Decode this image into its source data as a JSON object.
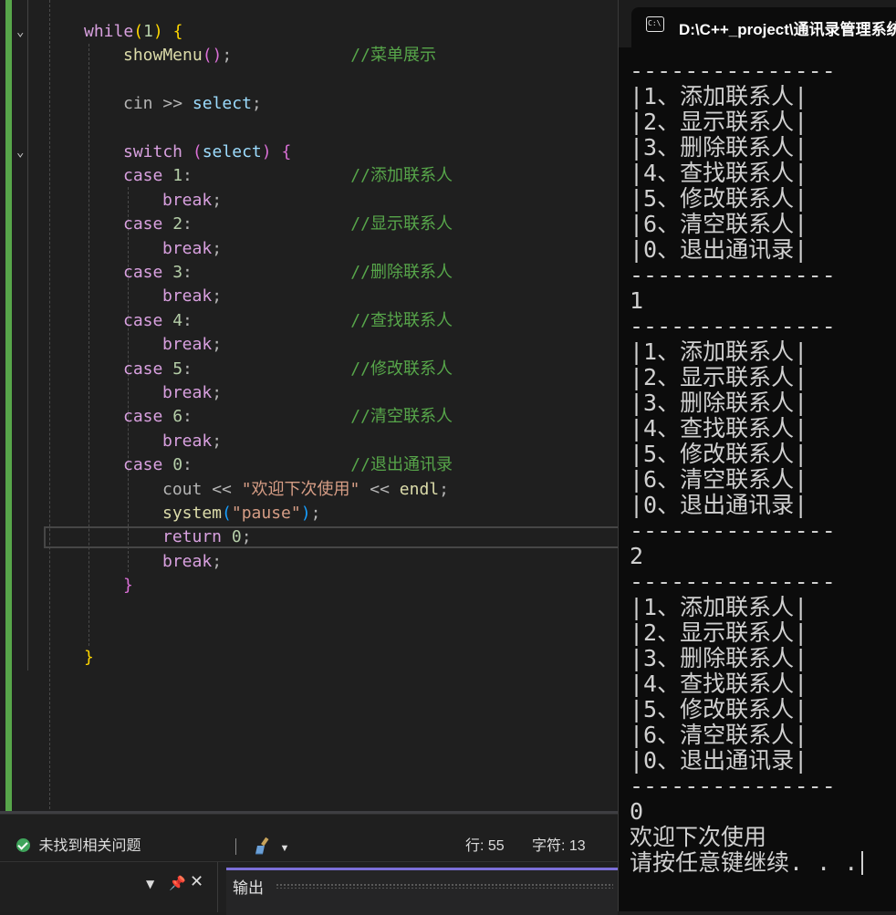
{
  "editor": {
    "lines": [
      {
        "indent": 0,
        "tokens": [
          [
            "kw",
            "while"
          ],
          [
            "br1",
            "("
          ],
          [
            "num",
            "1"
          ],
          [
            "br1",
            ")"
          ],
          [
            "op",
            " "
          ],
          [
            "br1",
            "{"
          ]
        ]
      },
      {
        "indent": 1,
        "tokens": [
          [
            "fn",
            "showMenu"
          ],
          [
            "br2",
            "()"
          ],
          [
            "op",
            ";"
          ],
          [
            "op",
            "            "
          ],
          [
            "cmt",
            "//菜单展示"
          ]
        ]
      },
      {
        "indent": 1,
        "tokens": []
      },
      {
        "indent": 1,
        "tokens": [
          [
            "op",
            "cin "
          ],
          [
            "op",
            ">>"
          ],
          [
            "op",
            " "
          ],
          [
            "var",
            "select"
          ],
          [
            "op",
            ";"
          ]
        ]
      },
      {
        "indent": 1,
        "tokens": []
      },
      {
        "indent": 1,
        "tokens": [
          [
            "kw",
            "switch"
          ],
          [
            "op",
            " "
          ],
          [
            "br2",
            "("
          ],
          [
            "var",
            "select"
          ],
          [
            "br2",
            ")"
          ],
          [
            "op",
            " "
          ],
          [
            "br2",
            "{"
          ]
        ]
      },
      {
        "indent": 1,
        "tokens": [
          [
            "kw",
            "case"
          ],
          [
            "op",
            " "
          ],
          [
            "num",
            "1"
          ],
          [
            "op",
            ":"
          ],
          [
            "op",
            "                "
          ],
          [
            "cmt",
            "//添加联系人"
          ]
        ]
      },
      {
        "indent": 2,
        "tokens": [
          [
            "kw",
            "break"
          ],
          [
            "op",
            ";"
          ]
        ]
      },
      {
        "indent": 1,
        "tokens": [
          [
            "kw",
            "case"
          ],
          [
            "op",
            " "
          ],
          [
            "num",
            "2"
          ],
          [
            "op",
            ":"
          ],
          [
            "op",
            "                "
          ],
          [
            "cmt",
            "//显示联系人"
          ]
        ]
      },
      {
        "indent": 2,
        "tokens": [
          [
            "kw",
            "break"
          ],
          [
            "op",
            ";"
          ]
        ]
      },
      {
        "indent": 1,
        "tokens": [
          [
            "kw",
            "case"
          ],
          [
            "op",
            " "
          ],
          [
            "num",
            "3"
          ],
          [
            "op",
            ":"
          ],
          [
            "op",
            "                "
          ],
          [
            "cmt",
            "//删除联系人"
          ]
        ]
      },
      {
        "indent": 2,
        "tokens": [
          [
            "kw",
            "break"
          ],
          [
            "op",
            ";"
          ]
        ]
      },
      {
        "indent": 1,
        "tokens": [
          [
            "kw",
            "case"
          ],
          [
            "op",
            " "
          ],
          [
            "num",
            "4"
          ],
          [
            "op",
            ":"
          ],
          [
            "op",
            "                "
          ],
          [
            "cmt",
            "//查找联系人"
          ]
        ]
      },
      {
        "indent": 2,
        "tokens": [
          [
            "kw",
            "break"
          ],
          [
            "op",
            ";"
          ]
        ]
      },
      {
        "indent": 1,
        "tokens": [
          [
            "kw",
            "case"
          ],
          [
            "op",
            " "
          ],
          [
            "num",
            "5"
          ],
          [
            "op",
            ":"
          ],
          [
            "op",
            "                "
          ],
          [
            "cmt",
            "//修改联系人"
          ]
        ]
      },
      {
        "indent": 2,
        "tokens": [
          [
            "kw",
            "break"
          ],
          [
            "op",
            ";"
          ]
        ]
      },
      {
        "indent": 1,
        "tokens": [
          [
            "kw",
            "case"
          ],
          [
            "op",
            " "
          ],
          [
            "num",
            "6"
          ],
          [
            "op",
            ":"
          ],
          [
            "op",
            "                "
          ],
          [
            "cmt",
            "//清空联系人"
          ]
        ]
      },
      {
        "indent": 2,
        "tokens": [
          [
            "kw",
            "break"
          ],
          [
            "op",
            ";"
          ]
        ]
      },
      {
        "indent": 1,
        "tokens": [
          [
            "kw",
            "case"
          ],
          [
            "op",
            " "
          ],
          [
            "num",
            "0"
          ],
          [
            "op",
            ":"
          ],
          [
            "op",
            "                "
          ],
          [
            "cmt",
            "//退出通讯录"
          ]
        ]
      },
      {
        "indent": 2,
        "tokens": [
          [
            "op",
            "cout "
          ],
          [
            "op",
            "<<"
          ],
          [
            "op",
            " "
          ],
          [
            "str",
            "\"欢迎下次使用\""
          ],
          [
            "op",
            " "
          ],
          [
            "op",
            "<<"
          ],
          [
            "op",
            " "
          ],
          [
            "fn",
            "endl"
          ],
          [
            "op",
            ";"
          ]
        ]
      },
      {
        "indent": 2,
        "tokens": [
          [
            "fn",
            "system"
          ],
          [
            "br3",
            "("
          ],
          [
            "str",
            "\"pause\""
          ],
          [
            "br3",
            ")"
          ],
          [
            "op",
            ";"
          ]
        ]
      },
      {
        "indent": 2,
        "tokens": [
          [
            "kw",
            "return"
          ],
          [
            "op",
            " "
          ],
          [
            "num",
            "0"
          ],
          [
            "op",
            ";"
          ]
        ]
      },
      {
        "indent": 2,
        "tokens": [
          [
            "kw",
            "break"
          ],
          [
            "op",
            ";"
          ]
        ]
      },
      {
        "indent": 1,
        "tokens": [
          [
            "br2",
            "}"
          ]
        ]
      },
      {
        "indent": 0,
        "tokens": []
      },
      {
        "indent": 0,
        "tokens": []
      },
      {
        "indent": 0,
        "tokens": [
          [
            "br1",
            "}"
          ]
        ]
      }
    ]
  },
  "statusbar": {
    "issues": "未找到相关问题",
    "row": "行: 55",
    "col": "字符: 13"
  },
  "panels": {
    "output_title": "输出"
  },
  "console": {
    "title": "D:\\C++_project\\通讯录管理系统",
    "icon_label": "C:\\",
    "lines": [
      "---------------",
      "|1、添加联系人|",
      "|2、显示联系人|",
      "|3、删除联系人|",
      "|4、查找联系人|",
      "|5、修改联系人|",
      "|6、清空联系人|",
      "|0、退出通讯录|",
      "---------------",
      "1",
      "---------------",
      "|1、添加联系人|",
      "|2、显示联系人|",
      "|3、删除联系人|",
      "|4、查找联系人|",
      "|5、修改联系人|",
      "|6、清空联系人|",
      "|0、退出通讯录|",
      "---------------",
      "2",
      "---------------",
      "|1、添加联系人|",
      "|2、显示联系人|",
      "|3、删除联系人|",
      "|4、查找联系人|",
      "|5、修改联系人|",
      "|6、清空联系人|",
      "|0、退出通讯录|",
      "---------------",
      "0",
      "欢迎下次使用",
      "请按任意键继续. . ."
    ]
  }
}
